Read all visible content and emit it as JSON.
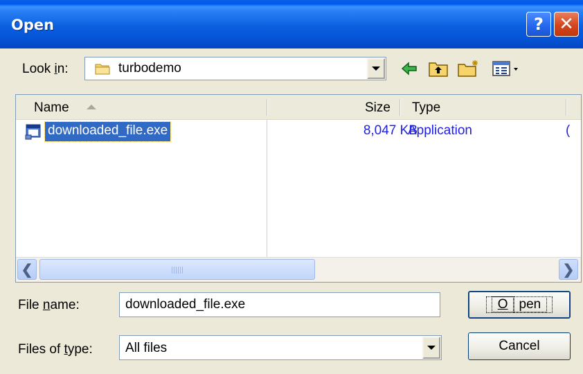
{
  "window": {
    "title": "Open"
  },
  "titlebar": {
    "help_glyph": "?",
    "close_glyph": "✕"
  },
  "look_in": {
    "label_pre": "Look ",
    "label_key": "i",
    "label_post": "n:",
    "value": "turbodemo",
    "icon": "folder-icon"
  },
  "toolbar": {
    "icons": [
      "back-icon",
      "up-folder-icon",
      "new-folder-icon",
      "view-menu-icon"
    ]
  },
  "file_list": {
    "columns": [
      "Name",
      "Size",
      "Type"
    ],
    "rows": [
      {
        "name": "downloaded_file.exe",
        "size": "8,047 KB",
        "type": "Application",
        "trailing": "(",
        "icon": "executable-file-icon"
      }
    ]
  },
  "scrollbar": {
    "left_arrow": "❮",
    "right_arrow": "❯"
  },
  "file_name": {
    "label_pre": "File ",
    "label_key": "n",
    "label_post": "ame:",
    "value": "downloaded_file.exe"
  },
  "files_of_type": {
    "label_pre": "Files of ",
    "label_key": "t",
    "label_post": "ype:",
    "value": "All files"
  },
  "buttons": {
    "open_key": "O",
    "open_rest": "pen",
    "cancel": "Cancel"
  },
  "colors": {
    "titlebar": "#0a5fe0",
    "selection": "#316ac5",
    "detail_text": "#2020e0",
    "dialog_bg": "#ece9d8"
  }
}
